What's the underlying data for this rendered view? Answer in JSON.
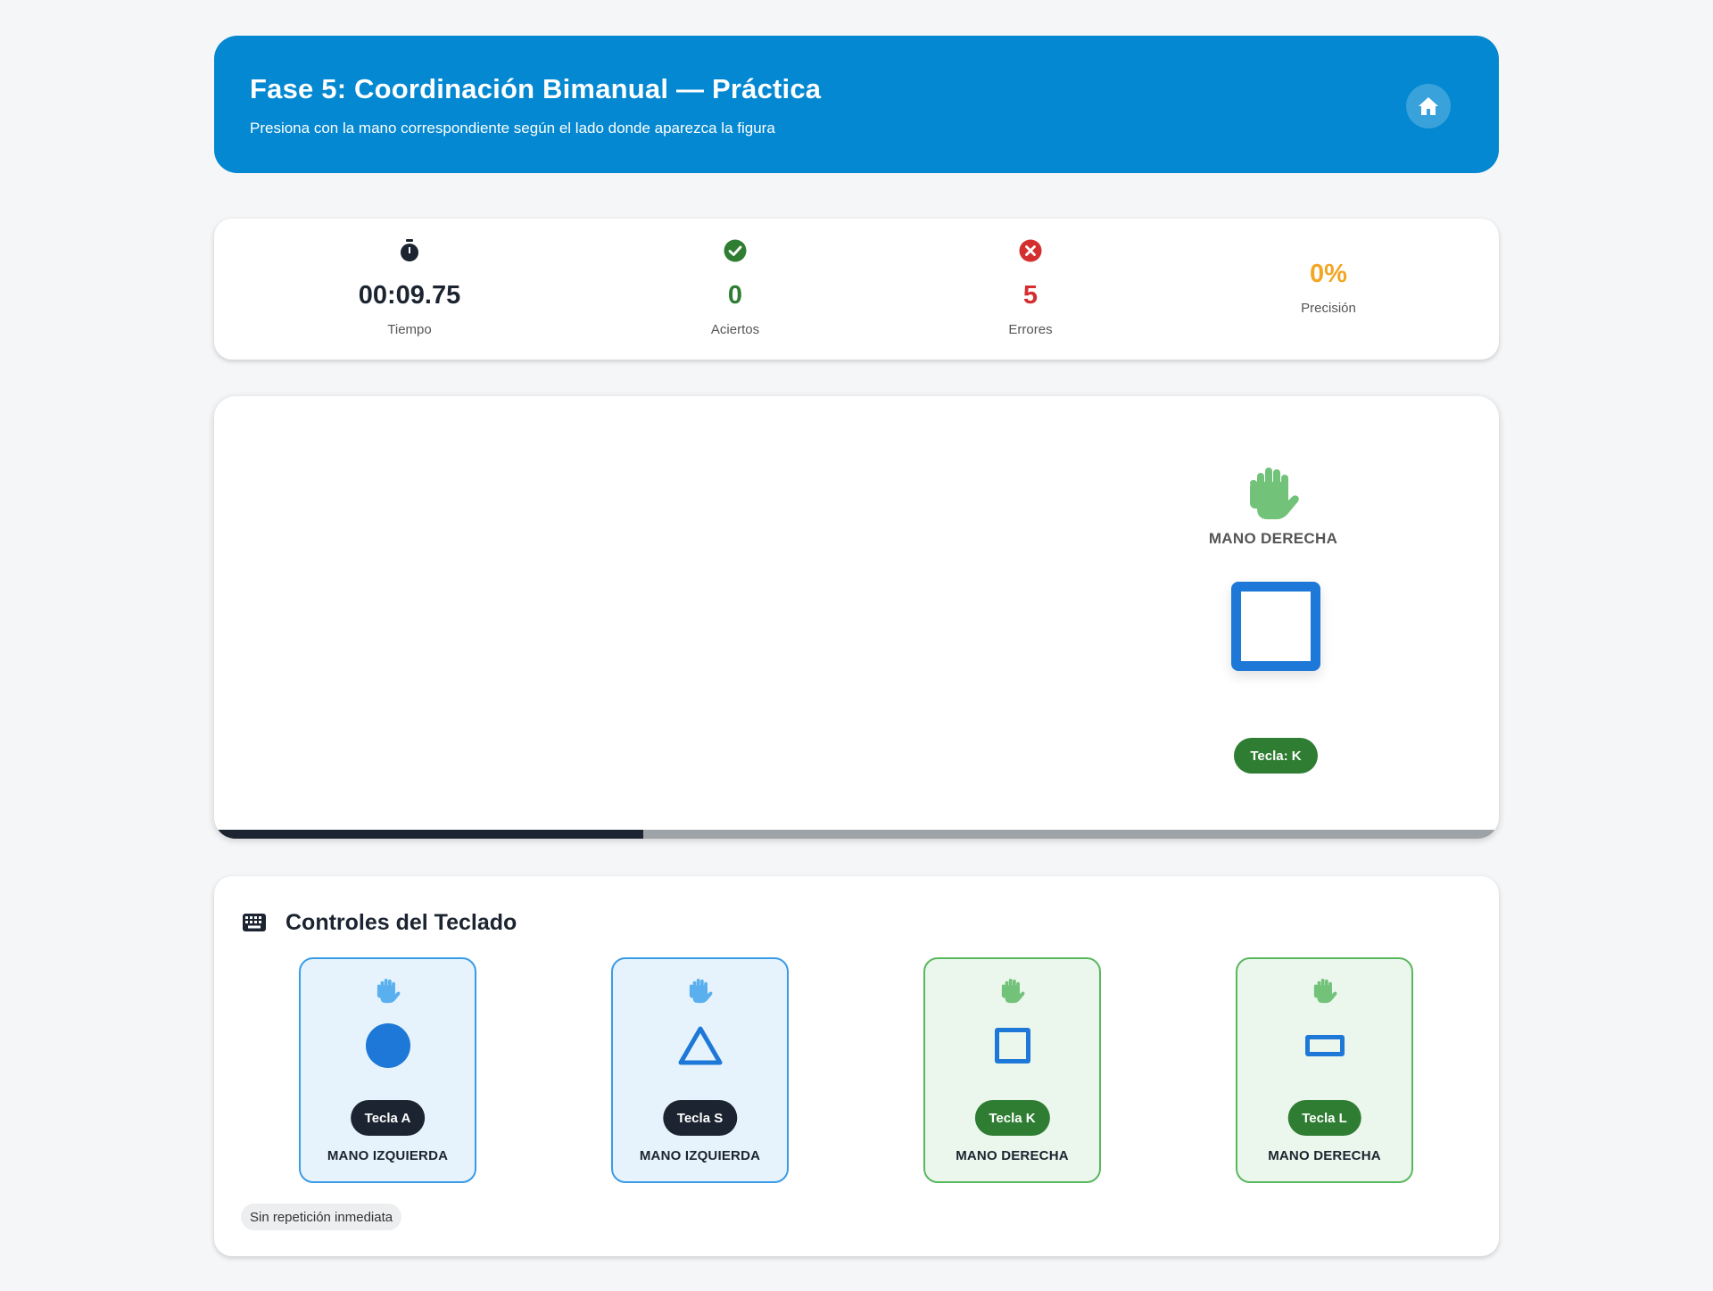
{
  "header": {
    "title": "Fase 5: Coordinación Bimanual — Práctica",
    "subtitle": "Presiona con la mano correspondiente según el lado donde aparezca la figura",
    "home_icon": "home-icon"
  },
  "stats": {
    "time": {
      "value": "00:09.75",
      "label": "Tiempo",
      "icon": "stopwatch-icon"
    },
    "hits": {
      "value": "0",
      "label": "Aciertos",
      "icon": "check-circle-icon",
      "color": "#2e7d32"
    },
    "errors": {
      "value": "5",
      "label": "Errores",
      "icon": "x-circle-icon",
      "color": "#d32f2f"
    },
    "precision": {
      "value": "0%",
      "label": "Precisión",
      "color": "#f2a623"
    }
  },
  "game": {
    "hand_label": "MANO DERECHA",
    "shape": "square",
    "key_label": "Tecla: K",
    "progress": 0.333
  },
  "controls": {
    "title": "Controles del Teclado",
    "cards": [
      {
        "shape": "circle",
        "key": "Tecla A",
        "hand": "MANO IZQUIERDA",
        "side": "left"
      },
      {
        "shape": "triangle",
        "key": "Tecla S",
        "hand": "MANO IZQUIERDA",
        "side": "left"
      },
      {
        "shape": "square",
        "key": "Tecla K",
        "hand": "MANO DERECHA",
        "side": "right"
      },
      {
        "shape": "rectangle",
        "key": "Tecla L",
        "hand": "MANO DERECHA",
        "side": "right"
      }
    ],
    "note": "Sin repetición inmediata"
  },
  "colors": {
    "primary": "#0388d1",
    "shape_blue": "#1e78d7",
    "left_hand": "#5ab0ee",
    "right_hand": "#72c27a"
  }
}
